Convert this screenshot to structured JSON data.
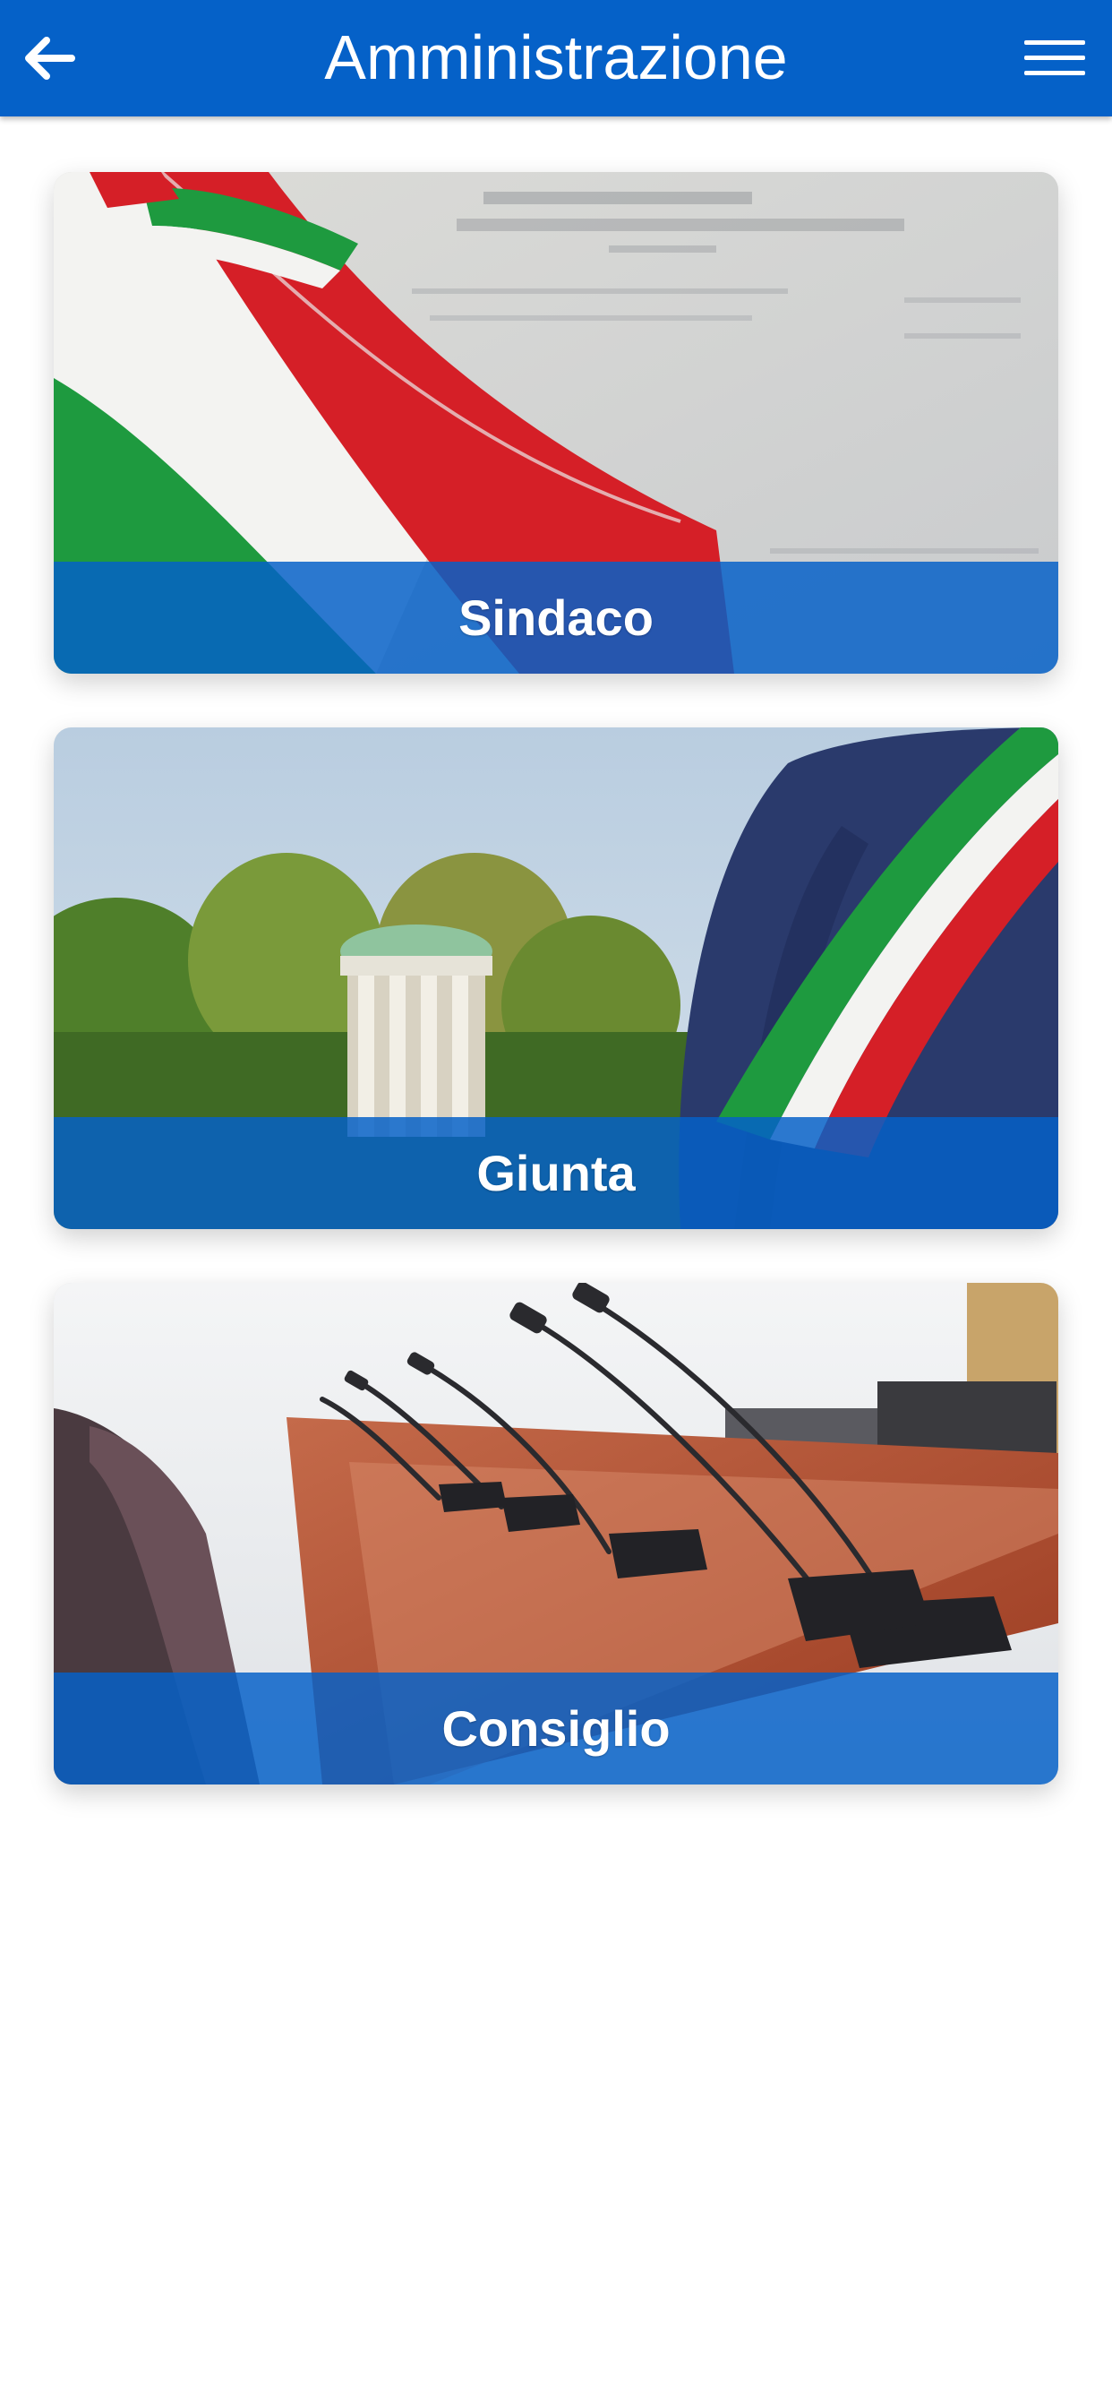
{
  "header": {
    "title": "Amministrazione",
    "back_icon": "arrow-left-icon",
    "menu_icon": "hamburger-menu-icon"
  },
  "theme": {
    "header_bg": "#0561c8",
    "caption_bg": "#0561c8",
    "text_color": "#ffffff",
    "page_bg": "#ffffff"
  },
  "cards": [
    {
      "label": "Sindaco",
      "image": "tricolor-sash-on-document"
    },
    {
      "label": "Giunta",
      "image": "mayor-with-tricolor-sash-and-park"
    },
    {
      "label": "Consiglio",
      "image": "council-chamber-microphones"
    }
  ]
}
